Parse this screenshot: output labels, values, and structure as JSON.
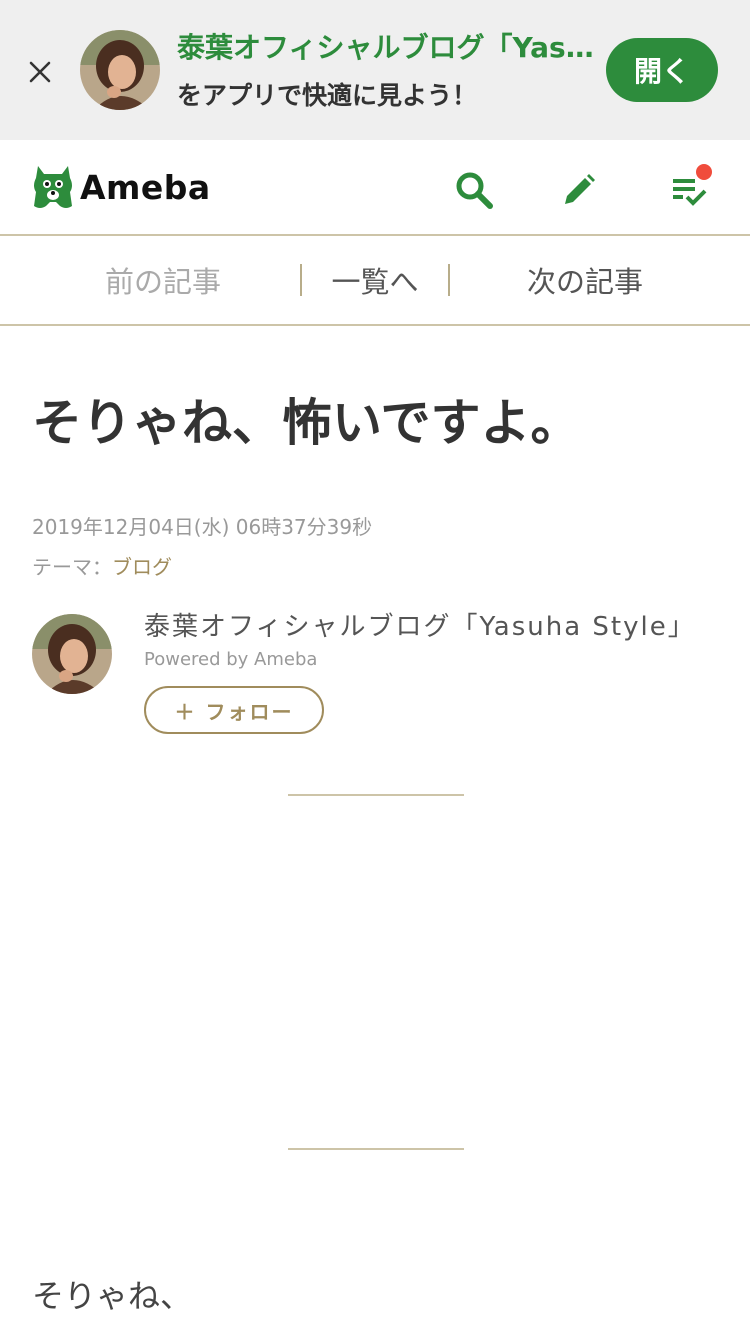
{
  "app_banner": {
    "title": "泰葉オフィシャルブログ「Yasuha Style」",
    "subtitle": "をアプリで快適に見よう！",
    "open_label": "開く",
    "close_icon": "close-icon",
    "accent_color": "#2d8c3c"
  },
  "header": {
    "logo_text": "Ameba",
    "icons": [
      "search-icon",
      "pencil-icon",
      "checklist-icon"
    ],
    "notification_dot_color": "#f04c3c"
  },
  "article_nav": {
    "prev": "前の記事",
    "list": "一覧へ",
    "next": "次の記事"
  },
  "article": {
    "title": "そりゃね、怖いですよ。",
    "date": "2019年12月04日(水) 06時37分39秒",
    "theme_label": "テーマ：",
    "theme_value": "ブログ",
    "body_first_line": "そりゃね、"
  },
  "author": {
    "name": "泰葉オフィシャルブログ「Yasuha Style」",
    "powered": "Powered by Ameba",
    "follow_label": "＋ フォロー"
  }
}
